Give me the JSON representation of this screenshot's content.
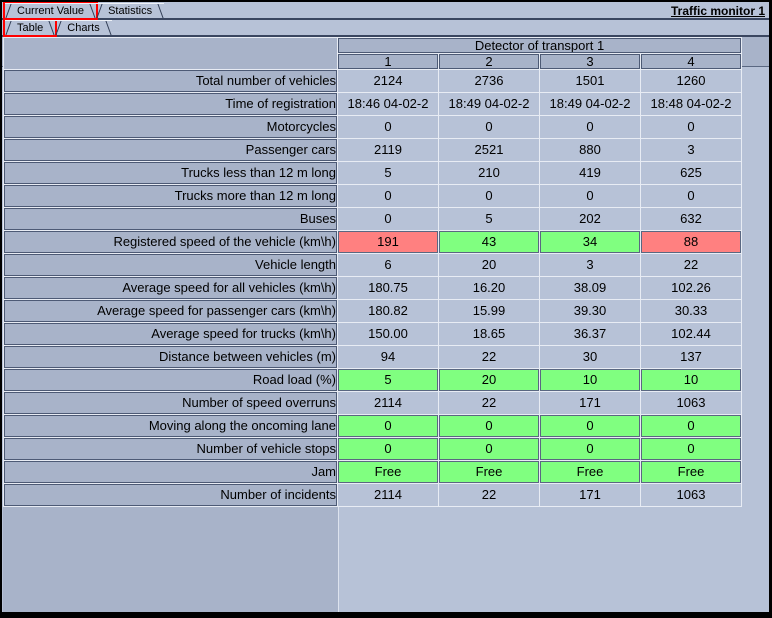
{
  "window": {
    "title": "Traffic monitor 1"
  },
  "tabs_row1": [
    {
      "label": "Current Value",
      "selected": true
    },
    {
      "label": "Statistics",
      "selected": false
    }
  ],
  "tabs_row2": [
    {
      "label": "Table",
      "selected": true
    },
    {
      "label": "Charts",
      "selected": false
    }
  ],
  "grid": {
    "group_header": "Detector of transport 1",
    "column_headers": [
      "1",
      "2",
      "3",
      "4"
    ],
    "rows": [
      {
        "label": "Total number of vehicles",
        "values": [
          "2124",
          "2736",
          "1501",
          "1260"
        ]
      },
      {
        "label": "Time of registration",
        "values": [
          "18:46 04-02-2",
          "18:49 04-02-2",
          "18:49 04-02-2",
          "18:48 04-02-2"
        ]
      },
      {
        "label": "Motorcycles",
        "values": [
          "0",
          "0",
          "0",
          "0"
        ]
      },
      {
        "label": "Passenger cars",
        "values": [
          "2119",
          "2521",
          "880",
          "3"
        ]
      },
      {
        "label": "Trucks less than 12 m long",
        "values": [
          "5",
          "210",
          "419",
          "625"
        ]
      },
      {
        "label": "Trucks more than 12 m long",
        "values": [
          "0",
          "0",
          "0",
          "0"
        ]
      },
      {
        "label": "Buses",
        "values": [
          "0",
          "5",
          "202",
          "632"
        ]
      },
      {
        "label": "Registered speed of the vehicle (km\\h)",
        "values": [
          "191",
          "43",
          "34",
          "88"
        ],
        "highlight": [
          "red",
          "green",
          "green",
          "red"
        ]
      },
      {
        "label": "Vehicle length",
        "values": [
          "6",
          "20",
          "3",
          "22"
        ]
      },
      {
        "label": "Average speed for all vehicles (km\\h)",
        "values": [
          "180.75",
          "16.20",
          "38.09",
          "102.26"
        ]
      },
      {
        "label": "Average speed for passenger cars (km\\h)",
        "values": [
          "180.82",
          "15.99",
          "39.30",
          "30.33"
        ]
      },
      {
        "label": "Average speed for trucks (km\\h)",
        "values": [
          "150.00",
          "18.65",
          "36.37",
          "102.44"
        ]
      },
      {
        "label": "Distance between vehicles (m)",
        "values": [
          "94",
          "22",
          "30",
          "137"
        ]
      },
      {
        "label": "Road load (%)",
        "values": [
          "5",
          "20",
          "10",
          "10"
        ],
        "highlight": [
          "green",
          "green",
          "green",
          "green"
        ]
      },
      {
        "label": "Number of speed overruns",
        "values": [
          "2114",
          "22",
          "171",
          "1063"
        ]
      },
      {
        "label": "Moving along the oncoming lane",
        "values": [
          "0",
          "0",
          "0",
          "0"
        ],
        "highlight": [
          "green",
          "green",
          "green",
          "green"
        ]
      },
      {
        "label": "Number of vehicle stops",
        "values": [
          "0",
          "0",
          "0",
          "0"
        ],
        "highlight": [
          "green",
          "green",
          "green",
          "green"
        ]
      },
      {
        "label": "Jam",
        "values": [
          "Free",
          "Free",
          "Free",
          "Free"
        ],
        "highlight": [
          "green",
          "green",
          "green",
          "green"
        ]
      },
      {
        "label": "Number of incidents",
        "values": [
          "2114",
          "22",
          "171",
          "1063"
        ]
      }
    ]
  },
  "colors": {
    "highlight_red": "#ff8080",
    "highlight_green": "#80ff80",
    "fixed_cell_bg": "#a8b3c9",
    "data_cell_bg": "#b7c2d7",
    "selection_outline": "#ff0000"
  }
}
